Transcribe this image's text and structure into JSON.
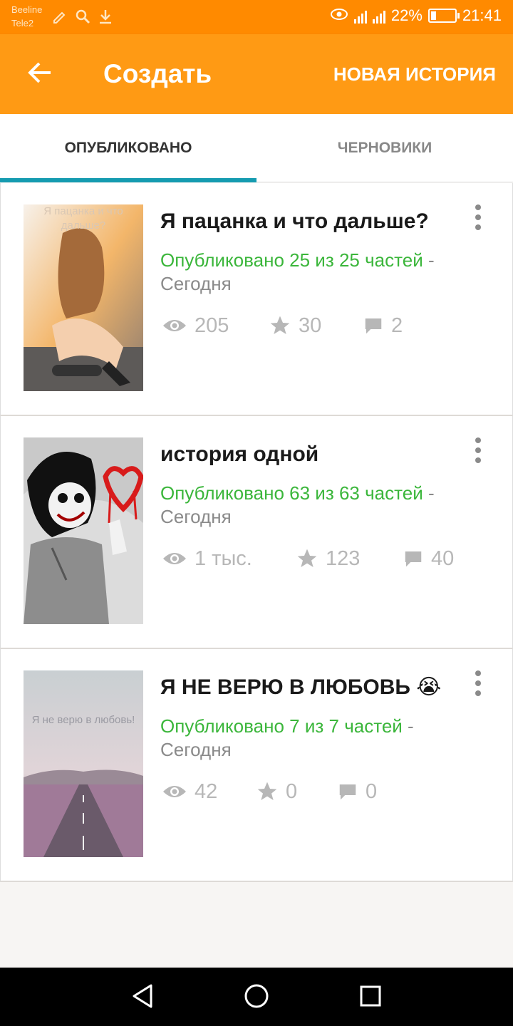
{
  "status_bar": {
    "carrier_1": "Beeline",
    "carrier_2": "Tele2",
    "battery_percent": "22%",
    "battery_level": 0.22,
    "time": "21:41",
    "icons": [
      "edit-icon",
      "search-icon",
      "download-icon",
      "eye-comfort-icon",
      "signal-icon",
      "battery-icon"
    ]
  },
  "app_bar": {
    "back_icon": "arrow-left-icon",
    "title": "Создать",
    "action_label": "НОВАЯ ИСТОРИЯ",
    "background_color": "#ff9a14"
  },
  "tabs": [
    {
      "label": "ОПУБЛИКОВАНО",
      "active": true
    },
    {
      "label": "ЧЕРНОВИКИ",
      "active": false
    }
  ],
  "accent_color": "#159bb0",
  "published_color": "#3bb63b",
  "stories": [
    {
      "cover_text": "Я пацанка и что дальше?",
      "title": "Я пацанка и что дальше?",
      "published_status": "Опубликовано 25 из 25 частей",
      "separator": "-",
      "date": "Сегодня",
      "views": "205",
      "votes": "30",
      "comments": "2"
    },
    {
      "cover_text": "",
      "title": "история одной",
      "published_status": "Опубликовано 63 из 63 частей",
      "separator": "-",
      "date": "Сегодня",
      "views": "1 тыс.",
      "votes": "123",
      "comments": "40"
    },
    {
      "cover_text": "Я не верю в любовь!",
      "title": "Я НЕ ВЕРЮ В ЛЮБОВЬ 😭",
      "published_status": "Опубликовано 7 из 7 частей",
      "separator": "-",
      "date": "Сегодня",
      "views": "42",
      "votes": "0",
      "comments": "0"
    }
  ],
  "nav_bar": {
    "buttons": [
      "back-triangle-icon",
      "home-circle-icon",
      "recents-square-icon"
    ]
  }
}
